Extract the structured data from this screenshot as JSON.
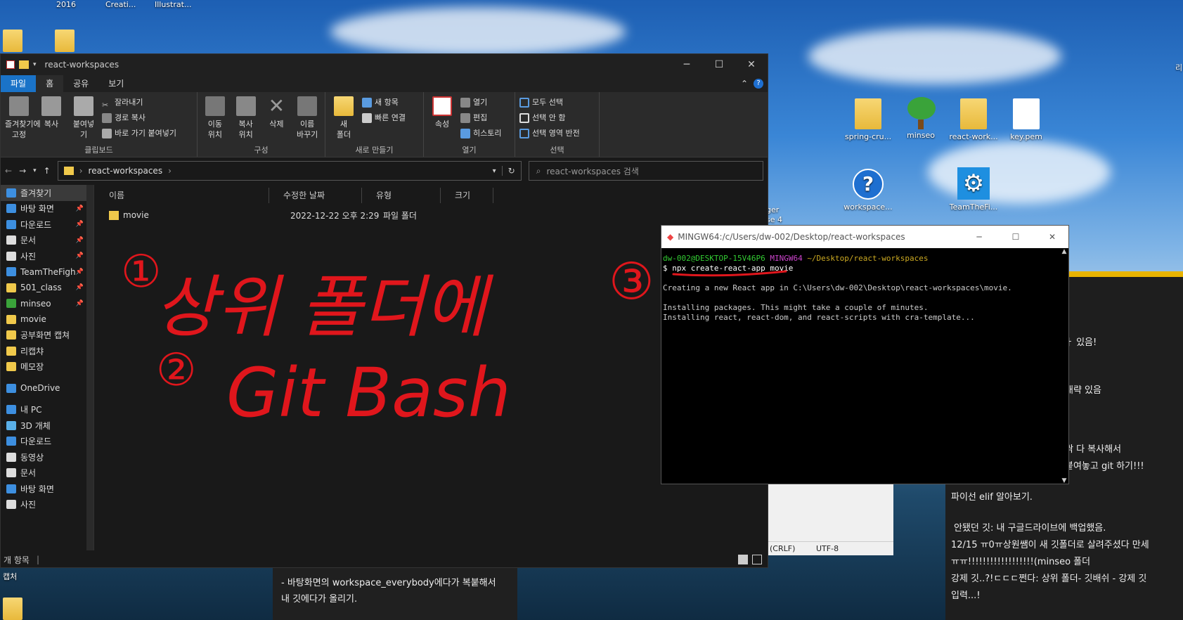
{
  "desktop": {
    "top_labels": [
      "2016",
      "Creati...",
      "Illustrat..."
    ],
    "icons": [
      {
        "label": "spring-cru...",
        "icon": "folder-icon"
      },
      {
        "label": "minseo",
        "icon": "tree-icon"
      },
      {
        "label": "react-work...",
        "icon": "folder-icon"
      },
      {
        "label": "key.pem",
        "icon": "file-icon"
      },
      {
        "label": "workspace...",
        "icon": "help-icon"
      },
      {
        "label": "TeamTheFi...",
        "icon": "gear-icon"
      }
    ],
    "partial_labels": [
      "ger",
      "se 4",
      "캡처",
      "리"
    ]
  },
  "explorer": {
    "title": "react-workspaces",
    "tabs": [
      "파일",
      "홈",
      "공유",
      "보기"
    ],
    "ribbon": {
      "clipboard": {
        "label": "클립보드",
        "pin": "즐겨찾기에\n고정",
        "copy": "복사",
        "paste": "붙여넣기",
        "cut": "잘라내기",
        "copy_path": "경로 복사",
        "paste_shortcut": "바로 가기 붙여넣기"
      },
      "organize": {
        "label": "구성",
        "move": "이동\n위치",
        "copyto": "복사\n위치",
        "delete": "삭제",
        "rename": "이름\n바꾸기"
      },
      "new": {
        "label": "새로 만들기",
        "new_folder": "새\n폴더",
        "new_item": "새 항목",
        "easy_access": "빠른 연결"
      },
      "open": {
        "label": "열기",
        "properties": "속성",
        "open": "열기",
        "edit": "편집",
        "history": "히스토리"
      },
      "select": {
        "label": "선택",
        "select_all": "모두 선택",
        "select_none": "선택 안 함",
        "invert": "선택 영역 반전"
      }
    },
    "address": "react-workspaces",
    "search_placeholder": "react-workspaces 검색",
    "nav": [
      {
        "label": "즐겨찾기",
        "pin": false,
        "sel": true,
        "color": "#3d8fe0"
      },
      {
        "label": "바탕 화면",
        "pin": true,
        "color": "#3d8fe0"
      },
      {
        "label": "다운로드",
        "pin": true,
        "color": "#3d8fe0"
      },
      {
        "label": "문서",
        "pin": true,
        "color": "#ddd"
      },
      {
        "label": "사진",
        "pin": true,
        "color": "#ddd"
      },
      {
        "label": "TeamTheFigh",
        "pin": true,
        "color": "#3d8fe0"
      },
      {
        "label": "501_class",
        "pin": true,
        "color": "#f0c94b"
      },
      {
        "label": "minseo",
        "pin": true,
        "color": "#3aa33a"
      },
      {
        "label": "movie",
        "pin": false,
        "color": "#f0c94b"
      },
      {
        "label": "공부화면 캡쳐",
        "pin": false,
        "color": "#f0c94b"
      },
      {
        "label": "리캡챠",
        "pin": false,
        "color": "#f0c94b"
      },
      {
        "label": "메모장",
        "pin": false,
        "color": "#f0c94b"
      },
      {
        "label": "OneDrive",
        "pin": false,
        "color": "#3d8fe0"
      },
      {
        "label": "내 PC",
        "pin": false,
        "color": "#3d8fe0"
      },
      {
        "label": "3D 개체",
        "pin": false,
        "color": "#5ab0e8"
      },
      {
        "label": "다운로드",
        "pin": false,
        "color": "#3d8fe0"
      },
      {
        "label": "동영상",
        "pin": false,
        "color": "#ddd"
      },
      {
        "label": "문서",
        "pin": false,
        "color": "#ddd"
      },
      {
        "label": "바탕 화면",
        "pin": false,
        "color": "#3d8fe0"
      },
      {
        "label": "사진",
        "pin": false,
        "color": "#ddd"
      }
    ],
    "columns": [
      "이름",
      "수정한 날짜",
      "유형",
      "크기"
    ],
    "files": [
      {
        "name": "movie",
        "date": "2022-12-22 오후 2:29",
        "type": "파일 폴더",
        "size": ""
      }
    ],
    "status": "개 항목"
  },
  "terminal": {
    "title": "MINGW64:/c/Users/dw-002/Desktop/react-workspaces",
    "prompt_user": "dw-002@DESKTOP-15V46P6",
    "prompt_env": "MINGW64",
    "prompt_path": "~/Desktop/react-workspaces",
    "command": "$ npx create-react-app movie",
    "out1": "Creating a new React app in C:\\Users\\dw-002\\Desktop\\react-workspaces\\movie.",
    "out2": "Installing packages. This might take a couple of minutes.",
    "out3": "Installing react, react-dom, and react-scripts with cra-template..."
  },
  "notepad": {
    "enc1": "(CRLF)",
    "enc2": "UTF-8"
  },
  "notes": {
    "lines": [
      "ㅏ 있음!",
      "대략 있음",
      "싹 다 복사해서",
      "붙여놓고 git 하기!!!",
      "파이선 elif 알아보기.",
      "안됐던 깃: 내 구글드라이브에 백업했음.",
      "12/15 ㅠ0ㅠ상원쌤이 새 깃폴더로 살려주셨다 만세",
      "ㅠㅠ!!!!!!!!!!!!!!!!!!(minseo 폴더",
      "강제 깃..?!ㄷㄷㄷ쩐다: 상위 폴더- 깃배쉬 - 강제 깃",
      "입력...!"
    ],
    "lower1": "- 바탕화면의 workspace_everybody에다가 복붙해서",
    "lower2": "내 깃에다가 올리기."
  },
  "annotations": {
    "n1": "①",
    "n2": "②",
    "n3": "③",
    "text1": "상위 폴더에",
    "text2": "Git Bash"
  }
}
